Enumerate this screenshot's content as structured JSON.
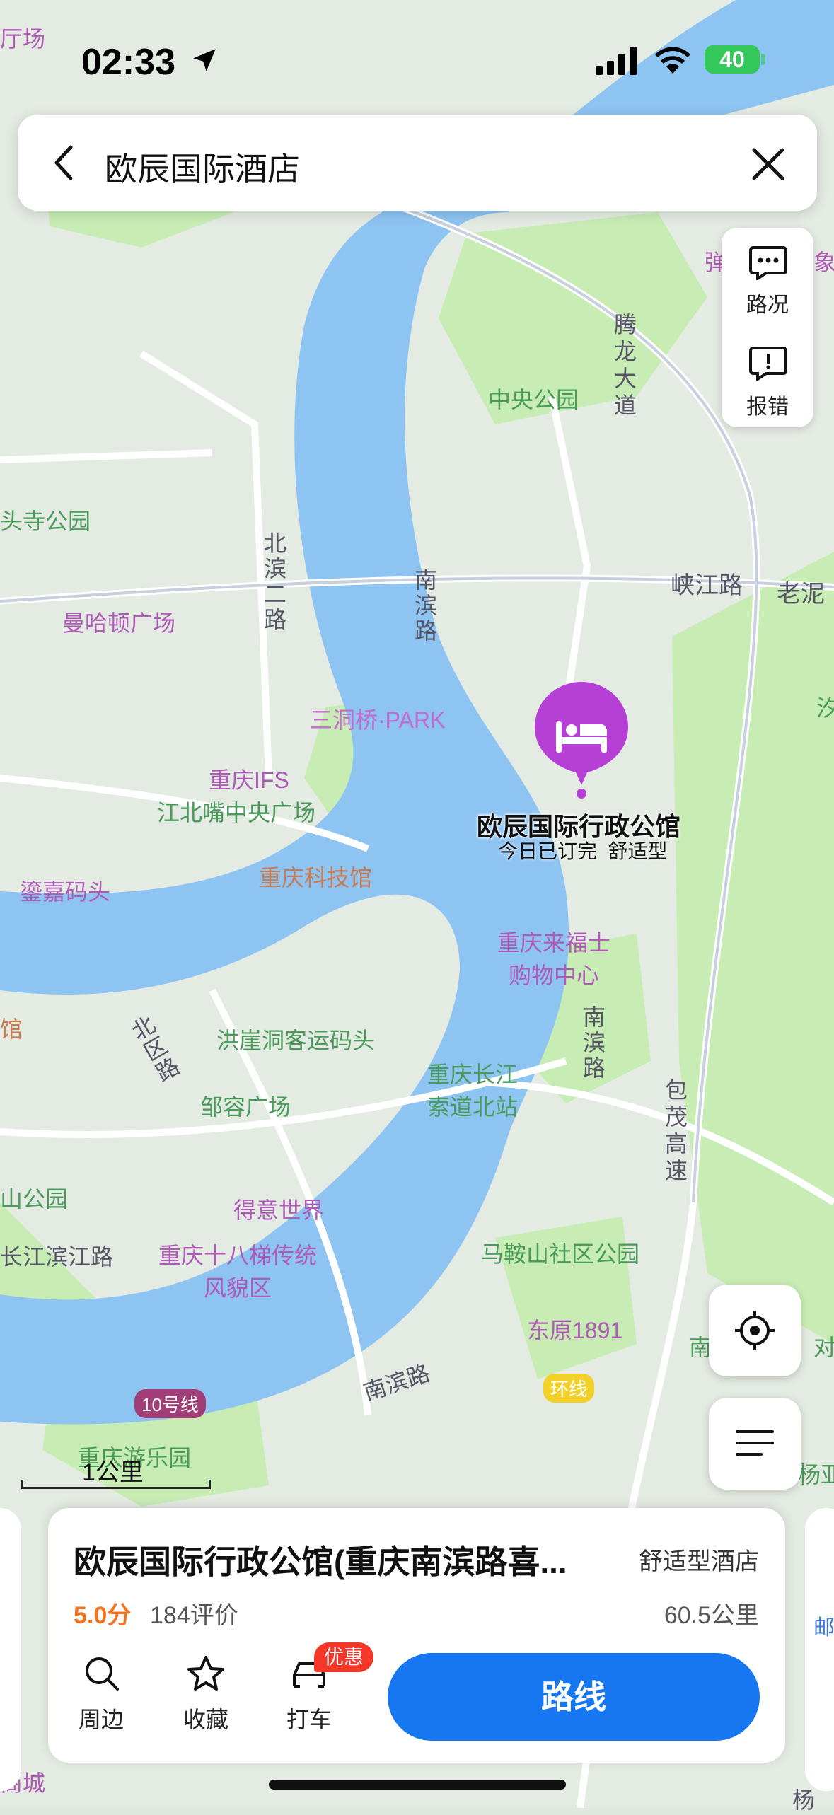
{
  "status_bar": {
    "time": "02:33",
    "battery": "40"
  },
  "search": {
    "query": "欧辰国际酒店"
  },
  "map_controls": {
    "traffic_label": "路况",
    "report_label": "报错"
  },
  "map_labels": {
    "central_park": "中央公园",
    "manhattan_square": "曼哈顿广场",
    "sandongqiao_park": "三洞桥·PARK",
    "chongqing_ifs": "重庆IFS",
    "jiangbeizui_square": "江北嘴中央广场",
    "science_museum": "重庆科技馆",
    "pier": "鎏嘉码头",
    "raffles_mall": "重庆来福士\n购物中心",
    "hongyadong_pier": "洪崖洞客运码头",
    "cableway_station": "重庆长江\n索道北站",
    "jierong_square": "邹容广场",
    "deyi_world": "得意世界",
    "shibati": "重庆十八梯传统\n风貌区",
    "maanshan_park": "马鞍山社区公园",
    "dongyuan": "东原1891",
    "amusement_park": "重庆游乐园",
    "temple_park": "头寺公园",
    "xiajiang_road": "峡江路",
    "laoni": "老泥",
    "beibin_road": "北\n滨\n二\n路",
    "nanbin_road_1": "南\n滨\n路",
    "nanbin_road_2": "南\n滨\n路",
    "nanbin_road_3": "南滨路",
    "tenglong_avenue": "腾\n龙\n大\n道",
    "baomao_highway": "包\n茂\n高\n速",
    "xiaoshi_road": "北\n区\n路",
    "changjiang_road": "长江滨江路",
    "line10": "10号线",
    "ring_line": "环线",
    "left_park": "山公园",
    "left_guan": "馆",
    "bottom_left": "商城",
    "bottom_right": "杨",
    "top_left": "厅场",
    "right_edge_1": "弹",
    "right_edge_2": "象",
    "right_edge_3": "汐",
    "right_edge_4": "南",
    "right_edge_5": "对",
    "right_edge_6": "杨亚",
    "right_edge_7": "邮"
  },
  "poi": {
    "name": "欧辰国际行政公馆",
    "subtitle": "今日已订完  舒适型"
  },
  "scale": {
    "label": "1公里"
  },
  "place_card": {
    "title": "欧辰国际行政公馆(重庆南滨路喜...",
    "category": "舒适型酒店",
    "rating": "5.0分",
    "reviews": "184评价",
    "distance": "60.5公里",
    "actions": {
      "nearby": "周边",
      "favorite": "收藏",
      "taxi": "打车",
      "taxi_badge": "优惠"
    },
    "route_button": "路线"
  },
  "colors": {
    "water": "#8ec4f2",
    "green": "#c9eeb4",
    "poi": "#b63fd6",
    "accent": "#1677f0",
    "rating": "#f5721f"
  }
}
